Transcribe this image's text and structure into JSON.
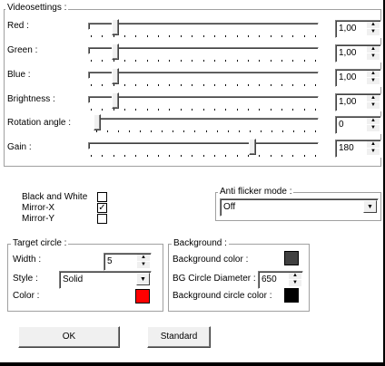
{
  "videosettings": {
    "legend": "Videosettings :",
    "red_label": "Red :",
    "red_value": "1,00",
    "green_label": "Green :",
    "green_value": "1,00",
    "blue_label": "Blue :",
    "blue_value": "1,00",
    "brightness_label": "Brightness :",
    "brightness_value": "1,00",
    "rotation_label": "Rotation angle :",
    "rotation_value": "0",
    "gain_label": "Gain :",
    "gain_value": "180"
  },
  "options": {
    "bw_label": "Black and White",
    "mirror_x_label": "Mirror-X",
    "mirror_x_checked": true,
    "mirror_y_label": "Mirror-Y",
    "check_mark": "✓"
  },
  "anti_flicker": {
    "legend": "Anti flicker mode :",
    "value": "Off"
  },
  "target_circle": {
    "legend": "Target circle :",
    "width_label": "Width :",
    "width_value": "5",
    "style_label": "Style :",
    "style_value": "Solid",
    "color_label": "Color :",
    "color": "#ff0000"
  },
  "background": {
    "legend": "Background :",
    "bg_color_label": "Background color :",
    "bg_color": "#404040",
    "diameter_label": "BG Circle Diameter :",
    "diameter_value": "650",
    "circle_color_label": "Background circle color :",
    "circle_color": "#000000"
  },
  "buttons": {
    "ok": "OK",
    "standard": "Standard"
  },
  "icons": {
    "up": "▲",
    "down": "▼"
  }
}
